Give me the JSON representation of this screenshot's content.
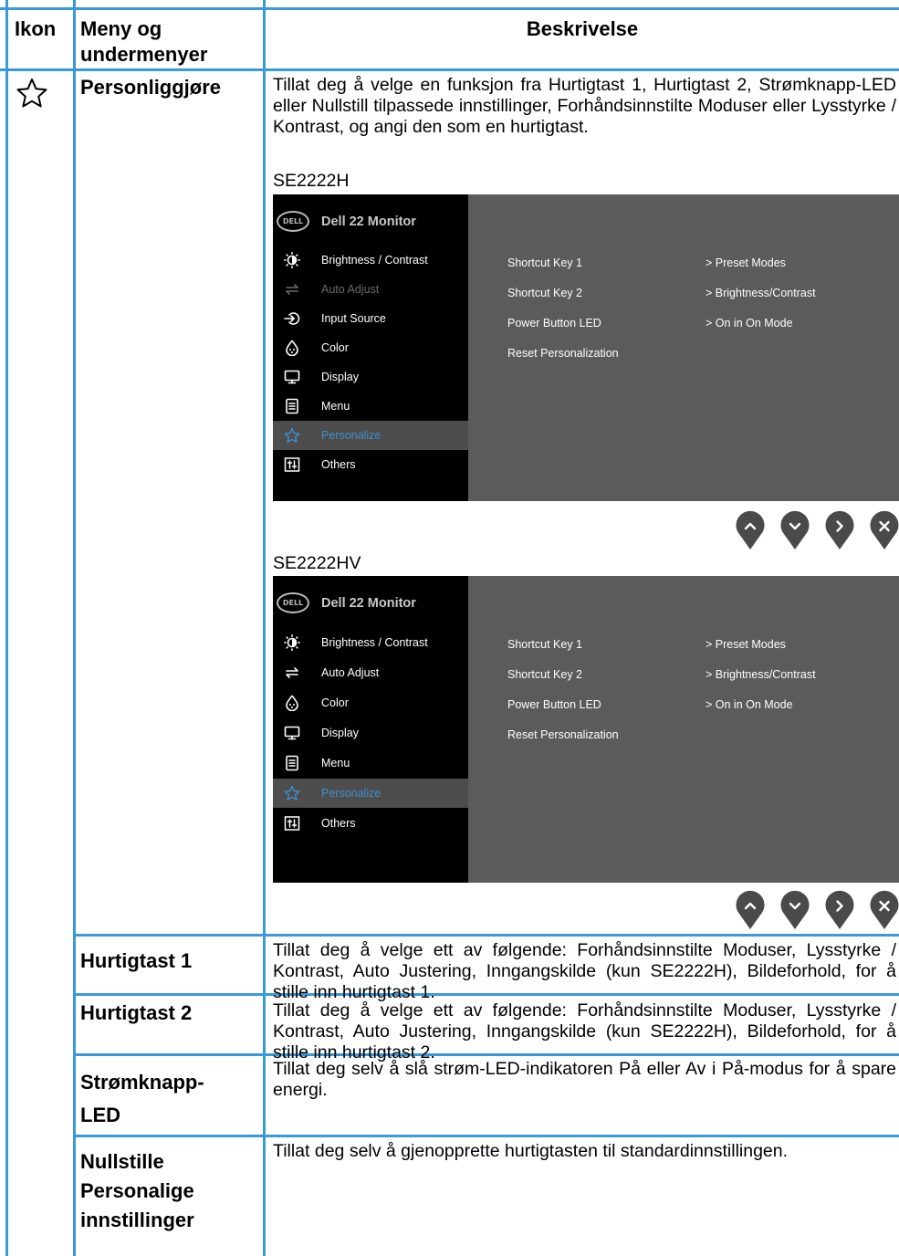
{
  "header": {
    "icon_col": "Ikon",
    "menu_col_line1": "Meny og",
    "menu_col_line2": "undermenyer",
    "desc_col": "Beskrivelse"
  },
  "personalize_row": {
    "icon": "star-outline-icon",
    "name": "Personliggjøre",
    "description": "Tillat deg å velge en funksjon fra Hurtigtast 1, Hurtigtast 2, Strømknapp-LED eller Nullstill tilpassede innstillinger, Forhåndsinnstilte Moduser eller Lysstyrke / Kontrast, og angi den som en hurtigtast."
  },
  "osd1": {
    "model": "SE2222H",
    "logo": "DELL",
    "title": "Dell 22 Monitor",
    "menu": [
      {
        "label": "Brightness / Contrast",
        "icon": "brightness-icon"
      },
      {
        "label": "Auto Adjust",
        "icon": "auto-adjust-icon"
      },
      {
        "label": "Input Source",
        "icon": "input-source-icon"
      },
      {
        "label": "Color",
        "icon": "color-palette-icon"
      },
      {
        "label": "Display",
        "icon": "display-monitor-icon"
      },
      {
        "label": "Menu",
        "icon": "menu-doc-icon"
      },
      {
        "label": "Personalize",
        "icon": "star-icon"
      },
      {
        "label": "Others",
        "icon": "others-icon"
      }
    ],
    "options": [
      "Shortcut Key 1",
      "Shortcut Key 2",
      "Power Button LED",
      "Reset Personalization"
    ],
    "values": [
      "> Preset Modes",
      "> Brightness/Contrast",
      "> On in On Mode"
    ],
    "buttons": [
      "up-icon",
      "down-icon",
      "next-icon",
      "close-icon"
    ]
  },
  "osd2": {
    "model": "SE2222HV",
    "logo": "DELL",
    "title": "Dell 22 Monitor",
    "menu": [
      {
        "label": "Brightness / Contrast",
        "icon": "brightness-icon"
      },
      {
        "label": "Auto Adjust",
        "icon": "auto-adjust-icon"
      },
      {
        "label": "Color",
        "icon": "color-palette-icon"
      },
      {
        "label": "Display",
        "icon": "display-monitor-icon"
      },
      {
        "label": "Menu",
        "icon": "menu-doc-icon"
      },
      {
        "label": "Personalize",
        "icon": "star-icon"
      },
      {
        "label": "Others",
        "icon": "others-icon"
      }
    ],
    "options": [
      "Shortcut Key 1",
      "Shortcut Key 2",
      "Power Button LED",
      "Reset Personalization"
    ],
    "values": [
      "> Preset Modes",
      "> Brightness/Contrast",
      "> On in On Mode"
    ],
    "buttons": [
      "up-icon",
      "down-icon",
      "next-icon",
      "close-icon"
    ]
  },
  "rows": [
    {
      "name": "Hurtigtast 1",
      "description": "Tillat deg å velge ett av følgende: Forhåndsinnstilte Moduser, Lysstyrke / Kontrast, Auto Justering, Inngangskilde (kun SE2222H), Bildeforhold, for å stille inn hurtigtast 1."
    },
    {
      "name": "Hurtigtast 2",
      "description": "Tillat deg å velge ett av følgende: Forhåndsinnstilte Moduser, Lysstyrke / Kontrast, Auto Justering, Inngangskilde (kun SE2222H), Bildeforhold, for å stille inn hurtigtast 2."
    },
    {
      "name_line1": "Strømknapp-",
      "name_line2": "LED",
      "description": "Tillat deg selv å slå strøm-LED-indikatoren På eller Av i På-modus for å spare energi."
    },
    {
      "name_line1": "Nullstille",
      "name_line2": "Personalige",
      "name_line3": "innstillinger",
      "description": "Tillat deg selv å gjenopprette hurtigtasten til standardinnstillingen."
    }
  ],
  "colors": {
    "table_border": "#3a9ad9",
    "osd_panel": "#5b5b5b",
    "osd_sidebar": "#000000",
    "osd_selected": "#3f8fd0",
    "button": "#4a4a4a"
  }
}
